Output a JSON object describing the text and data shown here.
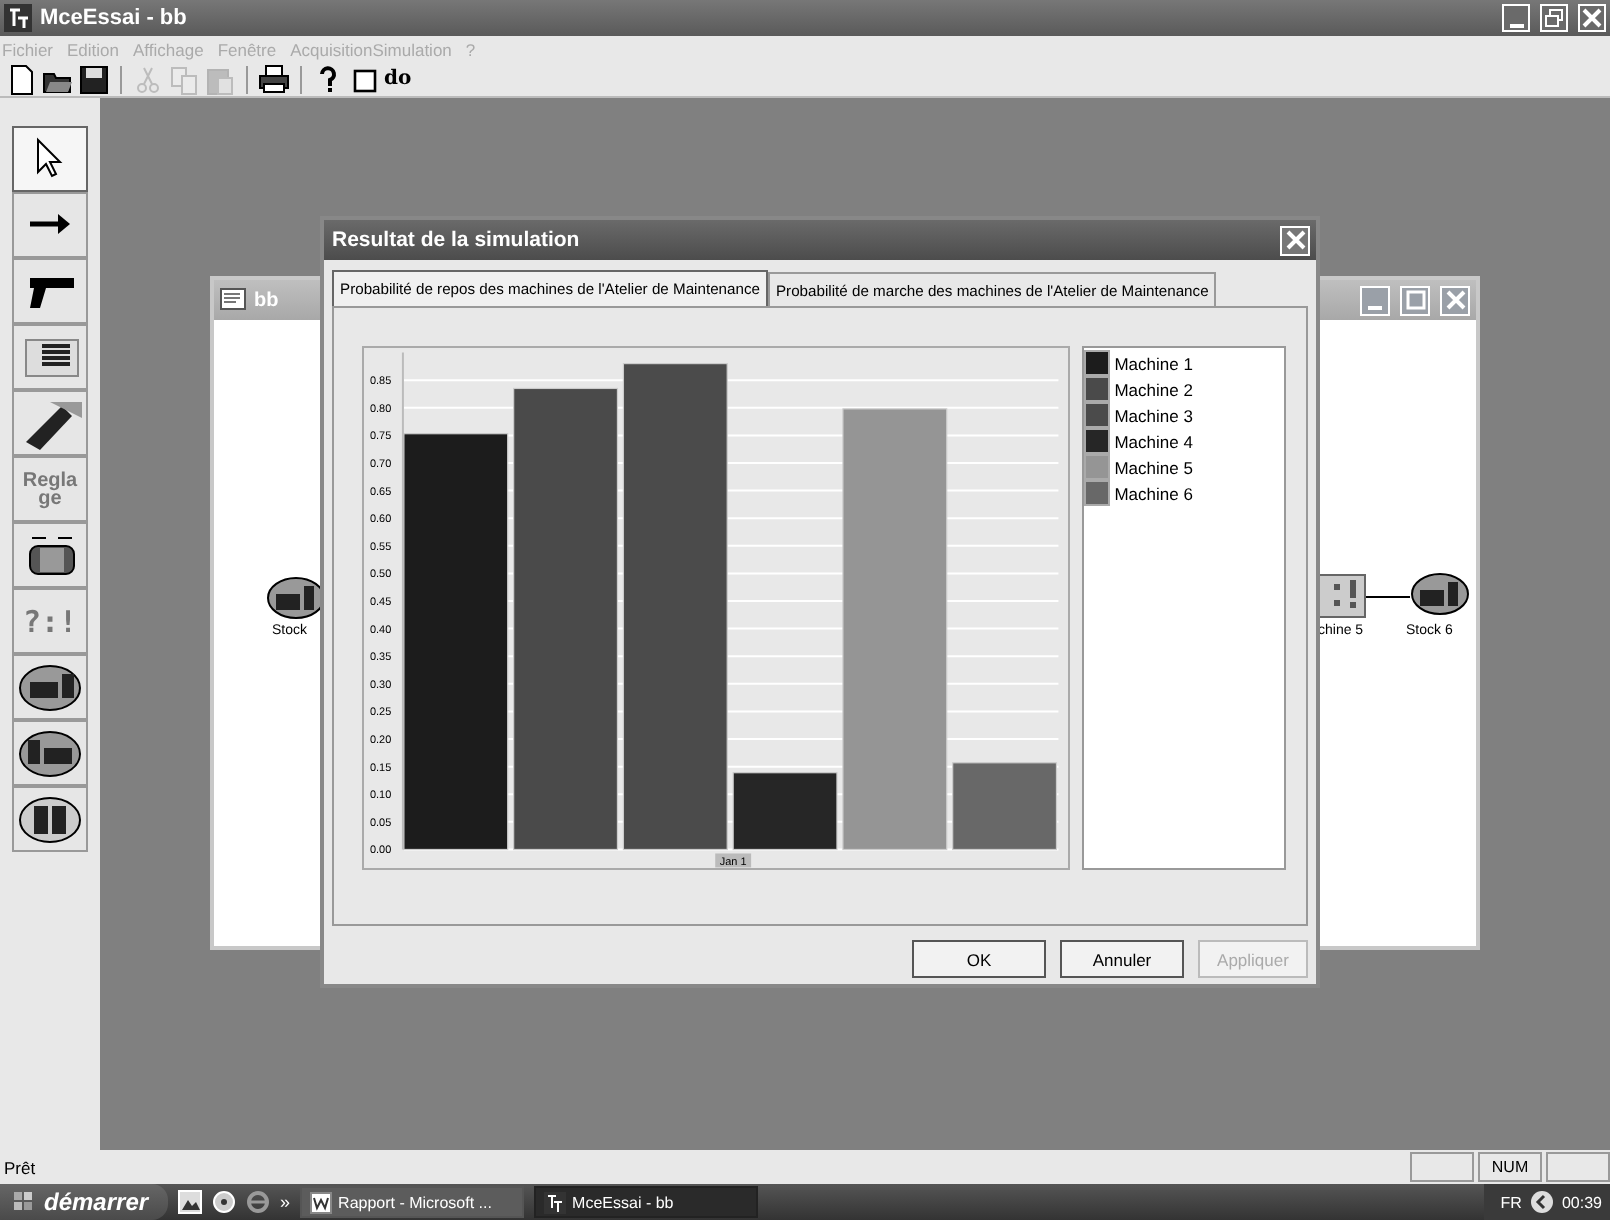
{
  "window": {
    "title": "MceEssai - bb"
  },
  "menu": [
    {
      "label": "Fichier"
    },
    {
      "label": "Edition"
    },
    {
      "label": "Affichage"
    },
    {
      "label": "Fenêtre"
    },
    {
      "label": "AcquisitionSimulation"
    },
    {
      "label": "?"
    }
  ],
  "toolbar": [
    {
      "kind": "icon",
      "disabled": false
    },
    {
      "kind": "icon",
      "disabled": false
    },
    {
      "kind": "icon",
      "disabled": false
    },
    {
      "kind": "separator"
    },
    {
      "kind": "icon",
      "disabled": true
    },
    {
      "kind": "icon",
      "disabled": true
    },
    {
      "kind": "icon",
      "disabled": true
    },
    {
      "kind": "separator"
    },
    {
      "kind": "icon",
      "disabled": false
    },
    {
      "kind": "separator"
    },
    {
      "kind": "icon",
      "disabled": false
    },
    {
      "kind": "icon",
      "disabled": false
    },
    {
      "kind": "text",
      "label": "do",
      "disabled": false
    }
  ],
  "tool_palette": [
    {
      "kind": "icon",
      "selected": true
    },
    {
      "kind": "icon",
      "selected": false
    },
    {
      "kind": "icon",
      "selected": false
    },
    {
      "kind": "icon",
      "selected": false
    },
    {
      "kind": "icon",
      "selected": false
    },
    {
      "kind": "text",
      "label": "Regla ge",
      "selected": false
    },
    {
      "kind": "icon",
      "selected": false
    },
    {
      "kind": "text",
      "label": "?:!",
      "selected": false
    },
    {
      "kind": "icon",
      "selected": false
    },
    {
      "kind": "icon",
      "selected": false
    },
    {
      "kind": "icon",
      "selected": false
    }
  ],
  "child_window": {
    "title": "bb",
    "nodes": [
      {
        "kind": "stock",
        "label": "Stock"
      },
      {
        "kind": "machine",
        "label": "chine 5"
      },
      {
        "kind": "stock",
        "label": "Stock 6"
      }
    ]
  },
  "dialog": {
    "title": "Resultat de la simulation",
    "tabs": [
      {
        "label": "Probabilité de repos des machines de l'Atelier de Maintenance",
        "selected": true
      },
      {
        "label": "Probabilité de marche des machines de l'Atelier de Maintenance",
        "selected": false
      }
    ],
    "chart_data": {
      "type": "bar",
      "categories": [
        "Jan 1"
      ],
      "series": [
        {
          "name": "Machine 1",
          "color": "#1c1c1c",
          "values": [
            0.753
          ]
        },
        {
          "name": "Machine 2",
          "color": "#4a4a4a",
          "values": [
            0.835
          ]
        },
        {
          "name": "Machine 3",
          "color": "#4b4b4b",
          "values": [
            0.88
          ]
        },
        {
          "name": "Machine 4",
          "color": "#262626",
          "values": [
            0.139
          ]
        },
        {
          "name": "Machine 5",
          "color": "#959595",
          "values": [
            0.798
          ]
        },
        {
          "name": "Machine 6",
          "color": "#686868",
          "values": [
            0.157
          ]
        }
      ],
      "ylim": [
        0,
        0.9
      ],
      "grid": true,
      "legend": "right",
      "yticks": [
        {
          "value": 0,
          "label": "0.00"
        },
        {
          "value": 0.05,
          "label": "0.05"
        },
        {
          "value": 0.1,
          "label": "0.10"
        },
        {
          "value": 0.15,
          "label": "0.15"
        },
        {
          "value": 0.2,
          "label": "0.20"
        },
        {
          "value": 0.25,
          "label": "0.25"
        },
        {
          "value": 0.3,
          "label": "0.30"
        },
        {
          "value": 0.35,
          "label": "0.35"
        },
        {
          "value": 0.4,
          "label": "0.40"
        },
        {
          "value": 0.45,
          "label": "0.45"
        },
        {
          "value": 0.5,
          "label": "0.50"
        },
        {
          "value": 0.55,
          "label": "0.55"
        },
        {
          "value": 0.6,
          "label": "0.60"
        },
        {
          "value": 0.65,
          "label": "0.65"
        },
        {
          "value": 0.7,
          "label": "0.70"
        },
        {
          "value": 0.75,
          "label": "0.75"
        },
        {
          "value": 0.8,
          "label": "0.80"
        },
        {
          "value": 0.85,
          "label": "0.85"
        }
      ]
    },
    "buttons": [
      {
        "label": "OK",
        "disabled": false
      },
      {
        "label": "Annuler",
        "disabled": false
      },
      {
        "label": "Appliquer",
        "disabled": true
      }
    ]
  },
  "status_bar": {
    "text": "Prêt",
    "panels": [
      {
        "kind": "blank"
      },
      {
        "kind": "text",
        "label": "NUM"
      },
      {
        "kind": "blank"
      }
    ]
  },
  "taskbar": {
    "start": "démarrer",
    "chevron": "»",
    "tasks": [
      {
        "label": "Rapport - Microsoft ...",
        "selected": false
      },
      {
        "label": "MceEssai - bb",
        "selected": true
      }
    ],
    "language": "FR",
    "clock": "00:39"
  }
}
